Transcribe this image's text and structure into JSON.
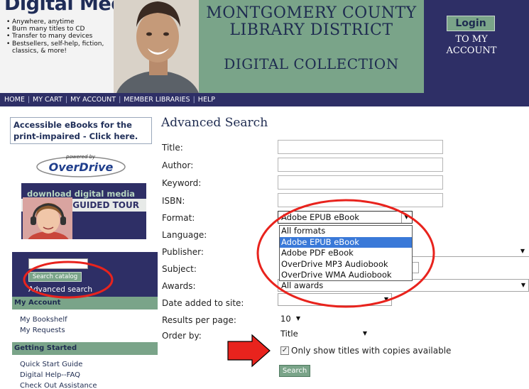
{
  "header": {
    "promo_title": "Digital Media",
    "promo_points": [
      "Anywhere, anytime",
      "Burn many titles to CD",
      "Transfer to many devices",
      "Bestsellers, self-help, fiction, classics, & more!"
    ],
    "library_line1": "MONTGOMERY COUNTY",
    "library_line2": "LIBRARY DISTRICT",
    "library_line3": "DIGITAL COLLECTION",
    "login_button": "Login",
    "login_line1": "TO MY",
    "login_line2": "ACCOUNT"
  },
  "nav": {
    "items": [
      "HOME",
      "MY CART",
      "MY ACCOUNT",
      "MEMBER LIBRARIES",
      "HELP"
    ],
    "separator": "|"
  },
  "sidebar": {
    "accessible_line1": "Accessible eBooks for the",
    "accessible_line2": "print-impaired - Click here.",
    "overdrive_powered": "powered by",
    "overdrive_name": "OverDrive",
    "tour_line1": "download digital media",
    "tour_line2": "GUIDED TOUR",
    "search_catalog_button": "Search catalog",
    "advanced_search_link": "Advanced search",
    "my_account_header": "My Account",
    "my_account_links": [
      "My Bookshelf",
      "My Requests"
    ],
    "getting_started_header": "Getting Started",
    "getting_started_links": [
      "Quick Start Guide",
      "Digital Help--FAQ",
      "Check Out Assistance"
    ]
  },
  "main": {
    "title": "Advanced Search",
    "labels": {
      "title": "Title:",
      "author": "Author:",
      "keyword": "Keyword:",
      "isbn": "ISBN:",
      "format": "Format:",
      "language": "Language:",
      "publisher": "Publisher:",
      "subject": "Subject:",
      "awards": "Awards:",
      "date_added": "Date added to site:",
      "results_per_page": "Results per page:",
      "order_by": "Order by:"
    },
    "format_selected": "Adobe EPUB eBook",
    "format_options": [
      "All formats",
      "Adobe EPUB eBook",
      "Adobe PDF eBook",
      "OverDrive MP3 Audiobook",
      "OverDrive WMA Audiobook"
    ],
    "awards_selected": "All awards",
    "results_selected": "10",
    "order_selected": "Title",
    "copies_checkbox_label": "Only show titles with copies available",
    "copies_checked": true,
    "search_button": "Search"
  },
  "colors": {
    "navy": "#2e2f66",
    "sage": "#7aa489",
    "highlight": "#3a79d8",
    "annotation_red": "#e8231d"
  },
  "icons": {
    "dropdown": "triangle-down-icon",
    "checkbox": "checkmark-icon",
    "pointer": "red-arrow-icon"
  }
}
